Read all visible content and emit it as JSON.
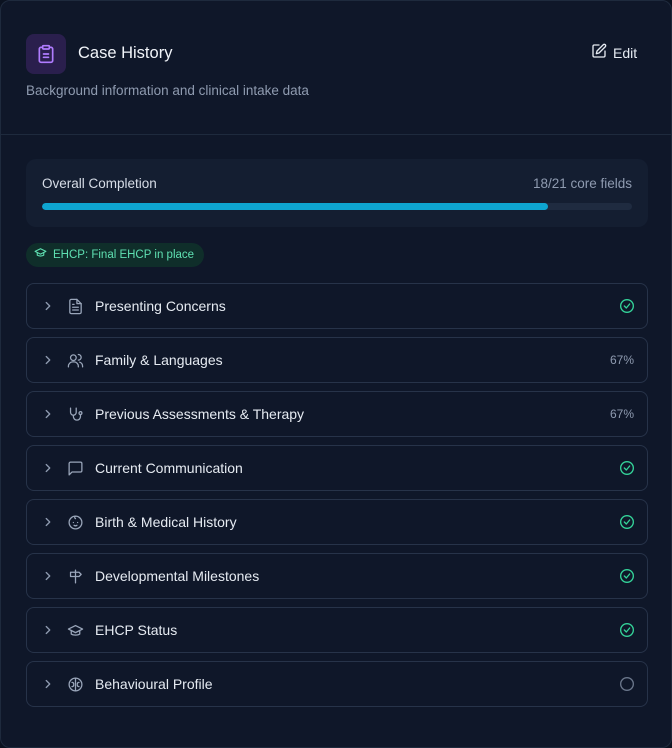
{
  "header": {
    "title": "Case History",
    "subtitle": "Background information and clinical intake data",
    "edit_label": "Edit",
    "icon": "clipboard-icon"
  },
  "completion": {
    "label": "Overall Completion",
    "count_text": "18/21 core fields",
    "fraction": 0.857
  },
  "ehcp_badge": {
    "text": "EHCP: Final EHCP in place",
    "icon": "graduation-cap-icon"
  },
  "colors": {
    "accent": "#0ea5d0",
    "success": "#34d399",
    "icon_bg": "#2a1f4d",
    "icon_fg": "#b07cff"
  },
  "sections": [
    {
      "label": "Presenting Concerns",
      "icon": "file-text-icon",
      "status": "complete"
    },
    {
      "label": "Family & Languages",
      "icon": "users-icon",
      "status": "partial",
      "percent": "67%"
    },
    {
      "label": "Previous Assessments & Therapy",
      "icon": "stethoscope-icon",
      "status": "partial",
      "percent": "67%"
    },
    {
      "label": "Current Communication",
      "icon": "message-square-icon",
      "status": "complete"
    },
    {
      "label": "Birth & Medical History",
      "icon": "baby-icon",
      "status": "complete"
    },
    {
      "label": "Developmental Milestones",
      "icon": "signpost-icon",
      "status": "complete"
    },
    {
      "label": "EHCP Status",
      "icon": "graduation-cap-icon",
      "status": "complete"
    },
    {
      "label": "Behavioural Profile",
      "icon": "brain-icon",
      "status": "empty"
    }
  ]
}
